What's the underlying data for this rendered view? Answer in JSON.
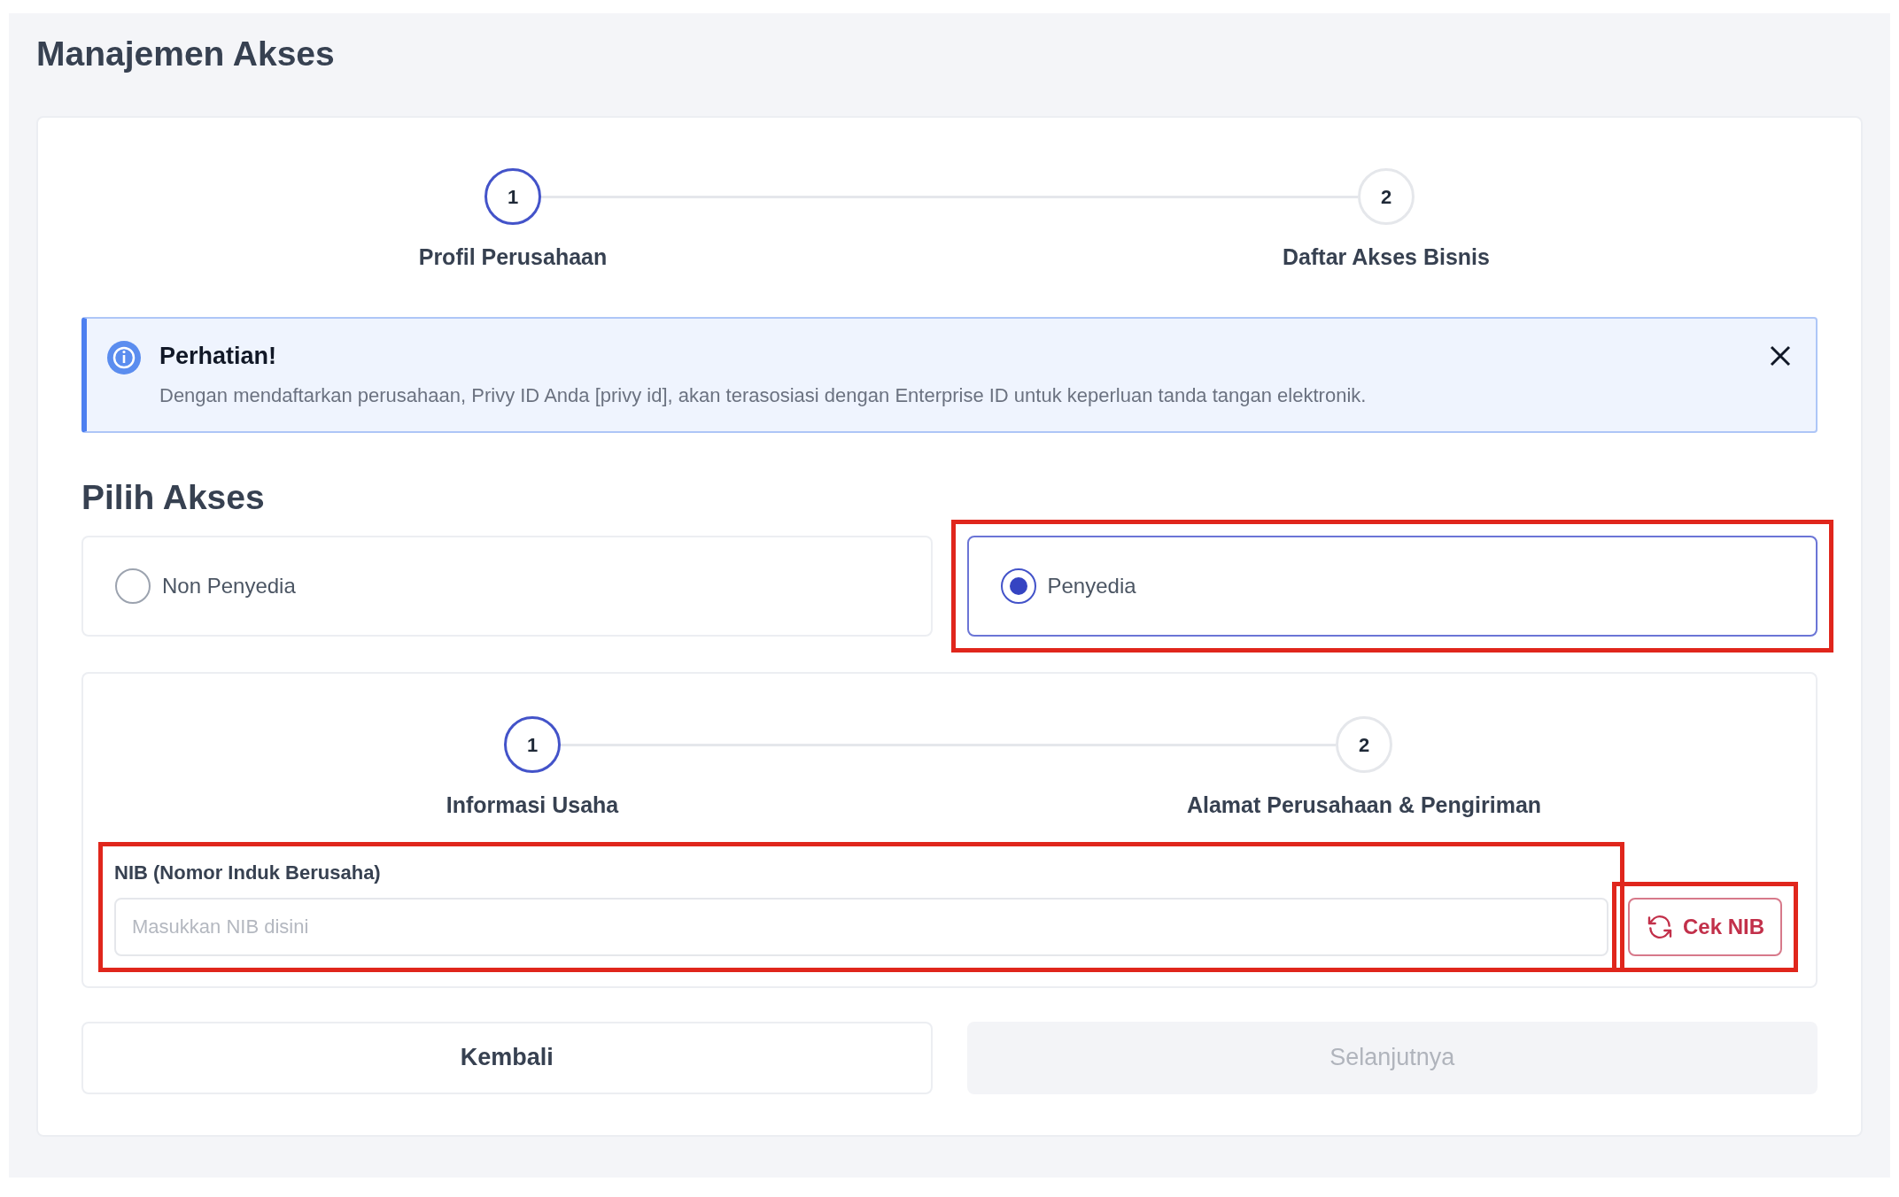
{
  "page": {
    "title": "Manajemen Akses"
  },
  "stepper": [
    {
      "number": "1",
      "label": "Profil Perusahaan",
      "selected": true
    },
    {
      "number": "2",
      "label": "Daftar Akses Bisnis",
      "selected": false
    }
  ],
  "alert": {
    "title": "Perhatian!",
    "message": "Dengan mendaftarkan perusahaan, Privy ID Anda [privy id], akan terasosiasi dengan Enterprise ID untuk keperluan tanda tangan elektronik."
  },
  "access": {
    "heading": "Pilih Akses",
    "options": [
      {
        "label": "Non Penyedia",
        "selected": false,
        "highlighted": false
      },
      {
        "label": "Penyedia",
        "selected": true,
        "highlighted": true
      }
    ]
  },
  "substepper": [
    {
      "number": "1",
      "label": "Informasi Usaha",
      "selected": true
    },
    {
      "number": "2",
      "label": "Alamat Perusahaan & Pengiriman",
      "selected": false
    }
  ],
  "nib": {
    "label": "NIB (Nomor Induk Berusaha)",
    "placeholder": "Masukkan NIB disini",
    "highlighted": true,
    "button": {
      "label": "Cek NIB",
      "highlighted": true
    }
  },
  "actions": [
    {
      "label": "Kembali",
      "disabled": false
    },
    {
      "label": "Selanjutnya",
      "disabled": true
    }
  ]
}
